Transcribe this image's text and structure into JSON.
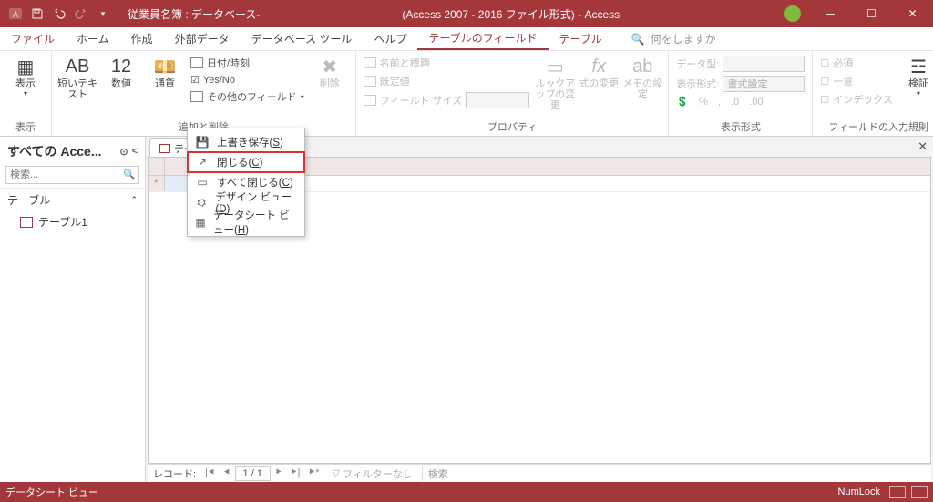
{
  "title": "従業員名簿 : データベース-　　　　　　　　　　　　　(Access 2007 - 2016 ファイル形式)  -  Access",
  "tabs": {
    "file": "ファイル",
    "home": "ホーム",
    "create": "作成",
    "external": "外部データ",
    "dbtools": "データベース ツール",
    "help": "ヘルプ",
    "fields": "テーブルのフィールド",
    "table": "テーブル",
    "tellme": "何をしますか"
  },
  "ribbon": {
    "group_view": "表示",
    "view": "表示",
    "short_text": "短いテキスト",
    "number": "数値",
    "currency": "通貨",
    "date_time": "日付/時刻",
    "yes_no": "Yes/No",
    "other_fields": "その他のフィールド",
    "group_add": "追加と削除",
    "delete": "削除",
    "name_caption": "名前と標題",
    "default_value": "既定値",
    "field_size": "フィールド サイズ",
    "lookup": "ルックアップの変更",
    "expr": "式の変更",
    "memo": "メモの設定",
    "group_prop": "プロパティ",
    "data_type": "データ型:",
    "display_fmt": "表示形式:",
    "format_val": "書式設定",
    "group_fmt": "表示形式",
    "required": "必須",
    "unique": "一意",
    "indexed": "インデックス",
    "validate": "検証",
    "group_valid": "フィールドの入力規則"
  },
  "nav": {
    "title": "すべての Acce...",
    "search_ph": "検索...",
    "section": "テーブル",
    "item1": "テーブル1"
  },
  "doc": {
    "tab": "テー",
    "new_row_marker": "*"
  },
  "context": {
    "save": "上書き保存(S)",
    "close": "閉じる(C)",
    "close_all": "すべて閉じる(C)",
    "design_view": "デザイン ビュー(D)",
    "datasheet_view": "データシート ビュー(H)"
  },
  "recnav": {
    "label": "レコード:",
    "pos": "1 / 1",
    "filter": "フィルターなし",
    "search": "検索"
  },
  "status": {
    "view": "データシート ビュー",
    "numlock": "NumLock"
  }
}
